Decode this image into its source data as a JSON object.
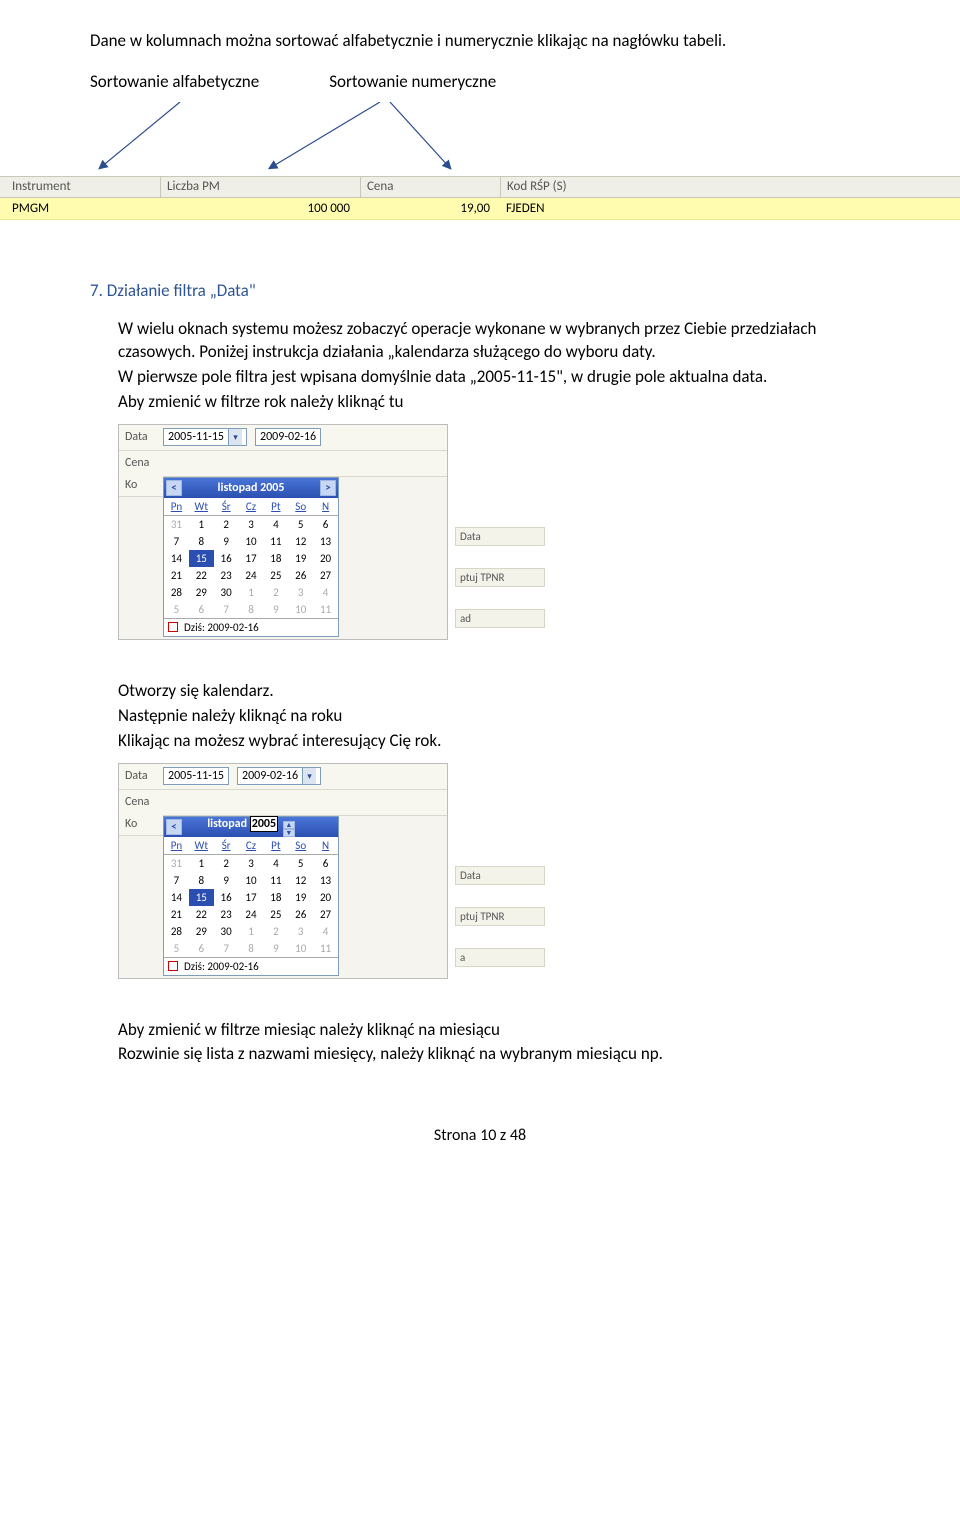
{
  "p1": "Dane w kolumnach można sortować  alfabetycznie i numerycznie klikając na nagłówku tabeli.",
  "sort_alpha": "Sortowanie alfabetyczne",
  "sort_num": "Sortowanie numeryczne",
  "cols": {
    "c1": "Instrument",
    "c2": "Liczba PM",
    "c3": "Cena",
    "c4": "Kod RŚP (S)"
  },
  "row": {
    "c1": "PMGM",
    "c2": "100 000",
    "c3": "19,00",
    "c4": "FJEDEN"
  },
  "section": {
    "num": "7.",
    "title": "Działanie filtra „Data\""
  },
  "b1": "W wielu oknach systemu możesz zobaczyć operacje wykonane w wybranych przez Ciebie przedziałach czasowych. Poniżej instrukcja działania „kalendarza służącego do wyboru daty.",
  "b2": "W pierwsze pole filtra jest wpisana domyślnie data „2005-11-15\", w drugie pole aktualna data.",
  "b3": "Aby zmienić w filtrze rok należy kliknąć tu",
  "b4": "Otworzy się kalendarz.",
  "b5": "Następnie należy kliknąć na roku",
  "b6": "Klikając na możesz wybrać interesujący Cię rok.",
  "b7": "Aby zmienić w filtrze miesiąc należy kliknąć na miesiącu",
  "b8": "Rozwinie się lista z nazwami miesięcy, należy kliknąć na wybranym miesiącu np.",
  "cal": {
    "label_data": "Data",
    "label_cena": "Cena",
    "label_ko": "Ko",
    "date1": "2005-11-15",
    "date2": "2009-02-16",
    "month1": "listopad",
    "year1": "2005",
    "days": [
      "Pn",
      "Wt",
      "Śr",
      "Cz",
      "Pt",
      "So",
      "N"
    ],
    "grid": [
      [
        "31",
        "1",
        "2",
        "3",
        "4",
        "5",
        "6"
      ],
      [
        "7",
        "8",
        "9",
        "10",
        "11",
        "12",
        "13"
      ],
      [
        "14",
        "15",
        "16",
        "17",
        "18",
        "19",
        "20"
      ],
      [
        "21",
        "22",
        "23",
        "24",
        "25",
        "26",
        "27"
      ],
      [
        "28",
        "29",
        "30",
        "1",
        "2",
        "3",
        "4"
      ],
      [
        "5",
        "6",
        "7",
        "8",
        "9",
        "10",
        "11"
      ]
    ],
    "today_label": "Dziś: 2009-02-16",
    "side1": "Data",
    "side2": "ptuj TPNR",
    "side3": "ad",
    "side4": "a"
  },
  "footer": "Strona 10 z 48"
}
